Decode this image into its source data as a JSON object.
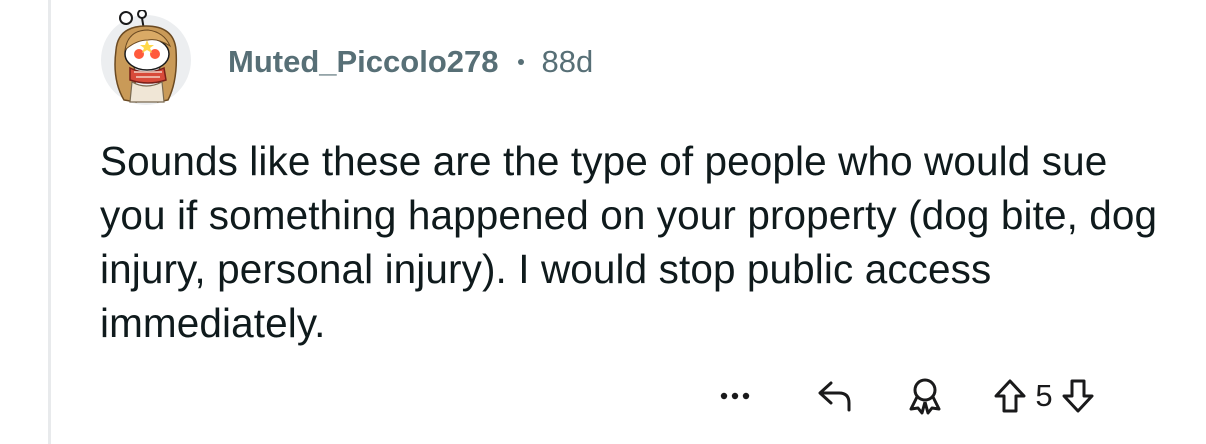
{
  "comment": {
    "username": "Muted_Piccolo278",
    "age": "88d",
    "text": "Sounds like these are the type of people who would sue you if something happened on your property (dog bite, dog injury, personal injury). I would stop public access immediately.",
    "score": "5"
  },
  "icons": {
    "avatar": "snoo-avatar",
    "more": "more-options-icon",
    "reply": "reply-icon",
    "award": "award-icon",
    "upvote": "upvote-icon",
    "downvote": "downvote-icon"
  },
  "colors": {
    "meta": "#576f76",
    "text": "#0f1a1c",
    "thread_line": "#e8eaec"
  }
}
